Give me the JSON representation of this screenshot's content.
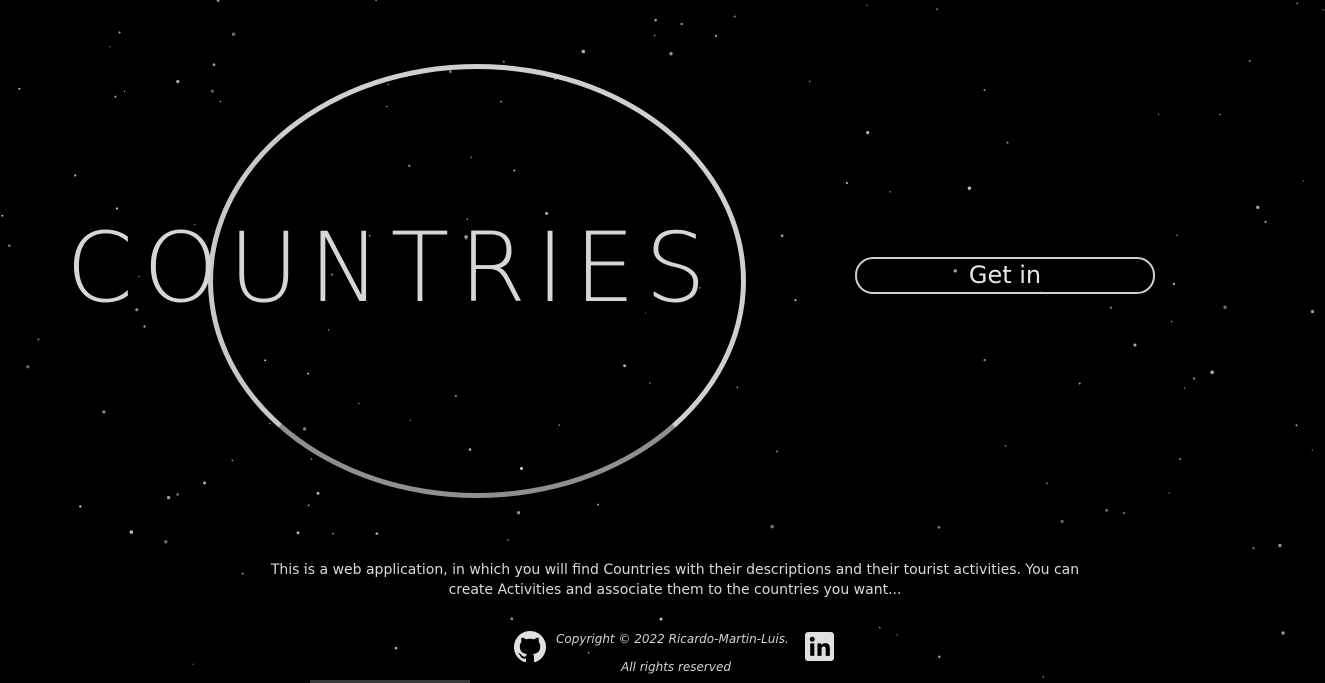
{
  "landing": {
    "title": "COUNTRIES",
    "get_in_label": "Get in",
    "description": "This is a web application, in which you will find Countries with their descriptions and their tourist activities. You can create Activities and associate them to the countries you want..."
  },
  "footer": {
    "copyright": "Copyright © 2022 Ricardo-Martin-Luis.",
    "rights": "All rights reserved",
    "github_icon": "github-icon",
    "linkedin_icon": "linkedin-icon"
  },
  "colors": {
    "background": "#000000",
    "text": "#d6d6d6",
    "ring": "#cfcfcf"
  }
}
